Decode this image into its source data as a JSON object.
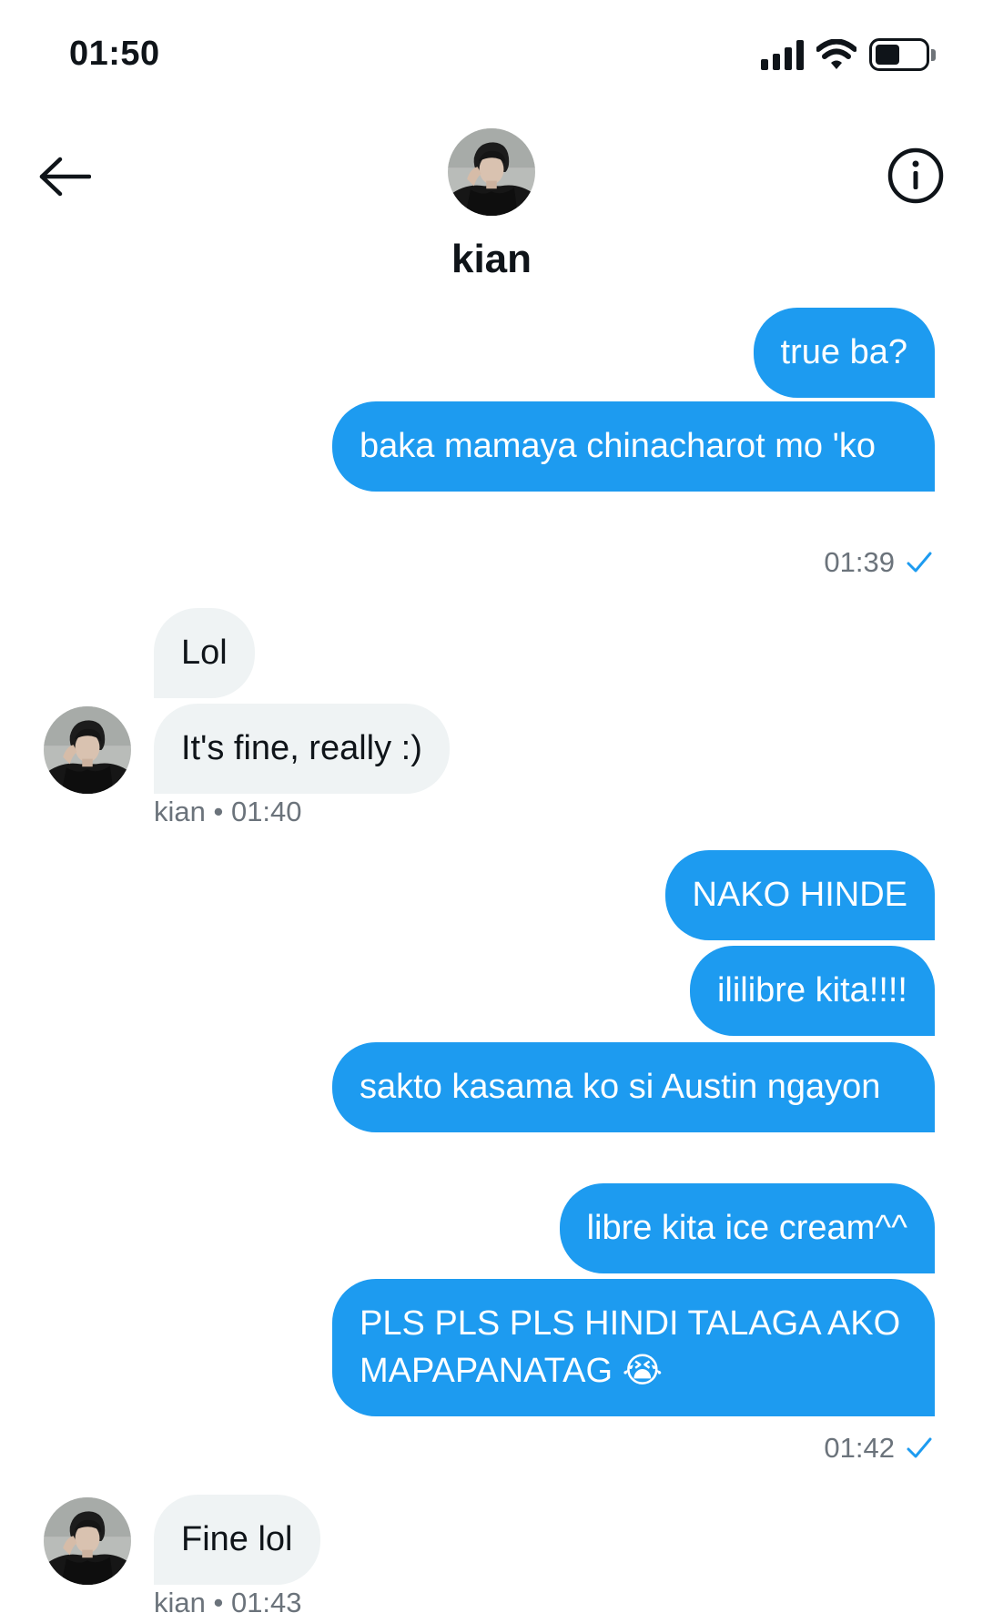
{
  "status_bar": {
    "time": "01:50",
    "icons": [
      "cellular-signal-icon",
      "wifi-icon",
      "battery-icon"
    ],
    "battery_level_percent": 50
  },
  "header": {
    "name": "kian",
    "icons": [
      "back-arrow-icon",
      "info-icon",
      "contact-avatar"
    ]
  },
  "colors": {
    "sent_bubble": "#1d9bf0",
    "received_bubble": "#eff3f4",
    "read_check": "#1d9bf0",
    "meta_text": "#6b737b"
  },
  "messages": [
    {
      "sender": "me",
      "text": "true ba?"
    },
    {
      "sender": "me",
      "text": "baka mamaya chinacharot mo 'ko"
    },
    {
      "sender": "them",
      "text": "Lol"
    },
    {
      "sender": "them",
      "text": "It's fine, really :)"
    },
    {
      "sender": "me",
      "text": "NAKO HINDE"
    },
    {
      "sender": "me",
      "text": "ililibre kita!!!!"
    },
    {
      "sender": "me",
      "text": "sakto kasama ko si Austin ngayon"
    },
    {
      "sender": "me",
      "text": "libre kita ice cream^^"
    },
    {
      "sender": "me",
      "text": "PLS PLS PLS HINDI TALAGA AKO MAPAPANATAG",
      "emoji": "😭"
    },
    {
      "sender": "them",
      "text": "Fine lol"
    }
  ],
  "timestamps": [
    {
      "text": "01:39",
      "read_icon": "checkmark-icon"
    },
    {
      "text": "kian • 01:40"
    },
    {
      "text": "01:42",
      "read_icon": "checkmark-icon"
    },
    {
      "text": "kian • 01:43"
    }
  ]
}
